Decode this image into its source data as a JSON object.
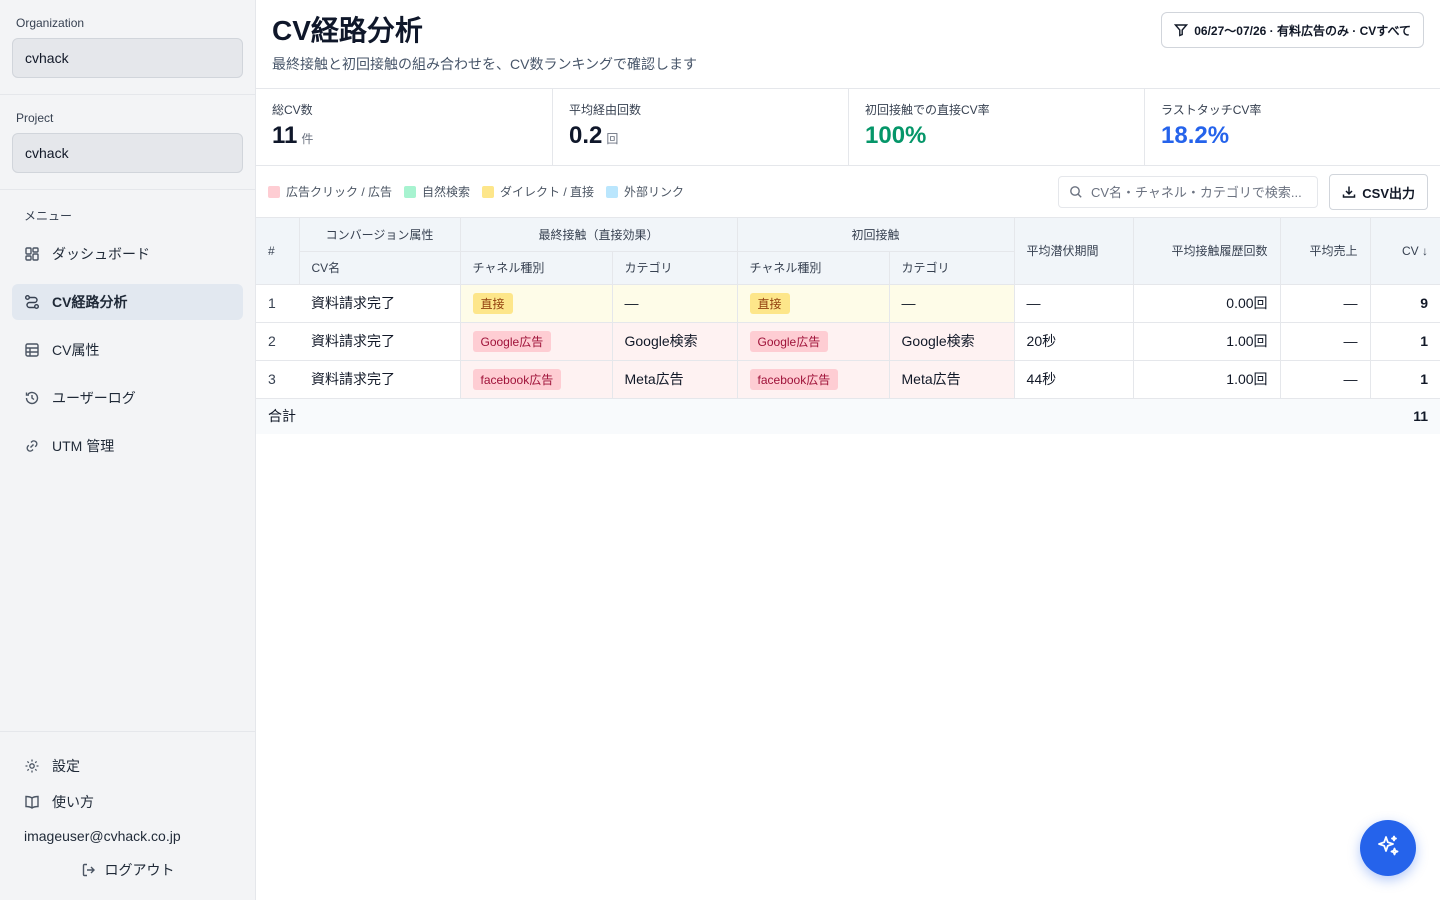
{
  "sidebar": {
    "organization_label": "Organization",
    "organization_value": "cvhack",
    "project_label": "Project",
    "project_value": "cvhack",
    "menu_label": "メニュー",
    "items": [
      {
        "label": "ダッシュボード",
        "icon": "dashboard-icon"
      },
      {
        "label": "CV経路分析",
        "icon": "route-icon",
        "active": true
      },
      {
        "label": "CV属性",
        "icon": "table-icon"
      },
      {
        "label": "ユーザーログ",
        "icon": "history-icon"
      },
      {
        "label": "UTM 管理",
        "icon": "link-icon"
      }
    ],
    "bottom": {
      "settings_label": "設定",
      "help_label": "使い方",
      "user_email": "imageuser@cvhack.co.jp",
      "logout_label": "ログアウト"
    }
  },
  "header": {
    "title": "CV経路分析",
    "subtitle": "最終接触と初回接触の組み合わせを、CV数ランキングで確認します",
    "filter_label": "06/27〜07/26 · 有料広告のみ · CVすべて"
  },
  "kpis": [
    {
      "label": "総CV数",
      "value": "11",
      "unit": "件"
    },
    {
      "label": "平均経由回数",
      "value": "0.2",
      "unit": "回"
    },
    {
      "label": "初回接触での直接CV率",
      "value": "100%",
      "unit": ""
    },
    {
      "label": "ラストタッチCV率",
      "value": "18.2%",
      "unit": ""
    }
  ],
  "legend": [
    {
      "label": "広告クリック / 広告",
      "color": "#fecdd3"
    },
    {
      "label": "自然検索",
      "color": "#a7f3d0"
    },
    {
      "label": "ダイレクト / 直接",
      "color": "#fde68a"
    },
    {
      "label": "外部リンク",
      "color": "#bae6fd"
    }
  ],
  "search": {
    "placeholder": "CV名・チャネル・カテゴリで検索..."
  },
  "csv_label": "CSV出力",
  "table": {
    "group_headers": {
      "hash": "#",
      "conversion": "コンバージョン属性",
      "last_touch": "最終接触（直接効果）",
      "first_touch": "初回接触",
      "latency": "平均潜伏期間",
      "touch_count": "平均接触履歴回数",
      "revenue": "平均売上",
      "cv": "CV ↓"
    },
    "sub_headers": {
      "cv_name": "CV名",
      "last_channel": "チャネル種別",
      "last_category": "カテゴリ",
      "first_channel": "チャネル種別",
      "first_category": "カテゴリ"
    },
    "rows": [
      {
        "idx": "1",
        "cv_name": "資料請求完了",
        "last_channel": "直接",
        "last_category": "—",
        "first_channel": "直接",
        "first_category": "—",
        "latency": "—",
        "touch_count": "0.00回",
        "revenue": "—",
        "cv": "9"
      },
      {
        "idx": "2",
        "cv_name": "資料請求完了",
        "last_channel": "Google広告",
        "last_category": "Google検索",
        "first_channel": "Google広告",
        "first_category": "Google検索",
        "latency": "20秒",
        "touch_count": "1.00回",
        "revenue": "—",
        "cv": "1"
      },
      {
        "idx": "3",
        "cv_name": "資料請求完了",
        "last_channel": "facebook広告",
        "last_category": "Meta広告",
        "first_channel": "facebook広告",
        "first_category": "Meta広告",
        "latency": "44秒",
        "touch_count": "1.00回",
        "revenue": "—",
        "cv": "1"
      }
    ],
    "total_label": "合計",
    "total_cv": "11"
  },
  "colors": {
    "accent": "#2563eb",
    "success": "#059669",
    "direct_tint": "#fefce8",
    "ad_tint": "#fef2f2"
  }
}
